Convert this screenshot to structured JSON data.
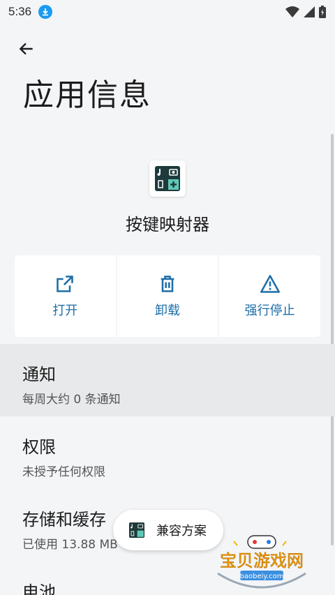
{
  "status_bar": {
    "time": "5:36"
  },
  "header": {
    "title": "应用信息"
  },
  "app": {
    "name": "按键映射器"
  },
  "actions": [
    {
      "label": "打开",
      "icon": "open-external-icon"
    },
    {
      "label": "卸载",
      "icon": "trash-icon"
    },
    {
      "label": "强行停止",
      "icon": "warning-icon"
    }
  ],
  "settings": {
    "notifications": {
      "title": "通知",
      "subtitle": "每周大约 0 条通知"
    },
    "permissions": {
      "title": "权限",
      "subtitle": "未授予任何权限"
    },
    "storage": {
      "title": "存储和缓存",
      "subtitle": "已使用 13.88 MB"
    },
    "battery": {
      "title": "电池"
    }
  },
  "compat_chip": {
    "label": "兼容方案"
  },
  "watermark": {
    "text": "宝贝游戏网",
    "url": "baobeiy.com"
  },
  "colors": {
    "accent": "#1d6ea8",
    "highlight": "#e8e9eb",
    "background": "#f4f5f7",
    "app_icon_bg": "#1e3a3a",
    "app_icon_teal": "#5fc9b7"
  }
}
